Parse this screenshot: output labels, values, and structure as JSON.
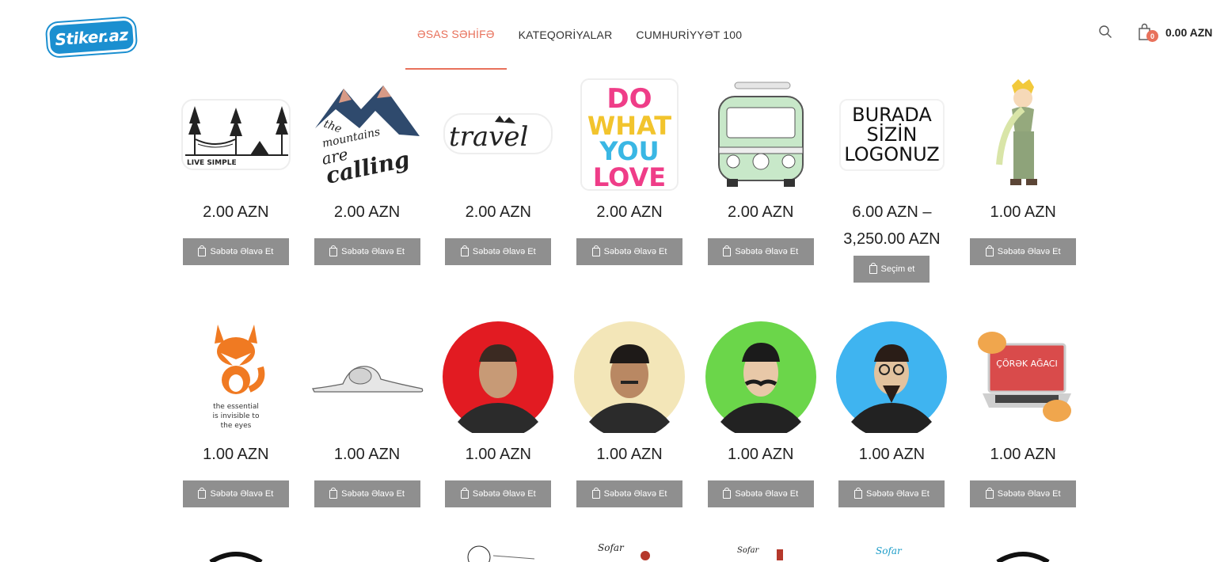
{
  "header": {
    "logo_text": "Stiker.az",
    "nav": [
      {
        "label": "ƏSAS SƏHİFƏ",
        "active": true
      },
      {
        "label": "KATEQORİYALAR",
        "active": false
      },
      {
        "label": "CUMHURİYYƏT 100",
        "active": false
      }
    ],
    "cart_count": "0",
    "cart_total": "0.00 AZN"
  },
  "colors": {
    "accent": "#e8715b",
    "button": "#8f8f8f",
    "logo": "#1b8fd0"
  },
  "products": [
    {
      "name": "live-simple-sticker",
      "price": "2.00 AZN",
      "button": "Səbətə Əlavə Et"
    },
    {
      "name": "mountains-are-calling-sticker",
      "price": "2.00 AZN",
      "button": "Səbətə Əlavə Et"
    },
    {
      "name": "travel-sticker",
      "price": "2.00 AZN",
      "button": "Səbətə Əlavə Et"
    },
    {
      "name": "do-what-you-love-sticker",
      "price": "2.00 AZN",
      "button": "Səbətə Əlavə Et"
    },
    {
      "name": "van-sticker",
      "price": "2.00 AZN",
      "button": "Səbətə Əlavə Et"
    },
    {
      "name": "logo-sticker",
      "price": "6.00 AZN – 3,250.00 AZN",
      "button": "Seçim et",
      "image_text": [
        "BURADA",
        "SİZİN",
        "LOGONUZ"
      ]
    },
    {
      "name": "little-prince-sticker",
      "price": "1.00 AZN",
      "button": "Səbətə Əlavə Et"
    },
    {
      "name": "fox-sticker",
      "price": "1.00 AZN",
      "button": "Səbətə Əlavə Et",
      "image_text": [
        "the essential",
        "is invisible to",
        "the eyes"
      ]
    },
    {
      "name": "elephant-boa-sticker",
      "price": "1.00 AZN",
      "button": "Səbətə Əlavə Et"
    },
    {
      "name": "portrait-red-sticker",
      "price": "1.00 AZN",
      "button": "Səbətə Əlavə Et"
    },
    {
      "name": "portrait-cream-sticker",
      "price": "1.00 AZN",
      "button": "Səbətə Əlavə Et"
    },
    {
      "name": "portrait-green-sticker",
      "price": "1.00 AZN",
      "button": "Səbətə Əlavə Et"
    },
    {
      "name": "portrait-blue-sticker",
      "price": "1.00 AZN",
      "button": "Səbətə Əlavə Et"
    },
    {
      "name": "corek-agaci-sticker",
      "price": "1.00 AZN",
      "button": "Səbətə Əlavə Et",
      "image_text": [
        "ÇÖRƏK AĞACI"
      ]
    }
  ],
  "art_text": {
    "live_simple": "LIVE SIMPLE",
    "mountains_1": "the",
    "mountains_2": "mountains",
    "mountains_3": "are",
    "mountains_4": "calling",
    "travel": "travel",
    "do_what": [
      "DO",
      "WHAT",
      "YOU",
      "LOVE"
    ],
    "sofar": "Sofar"
  }
}
